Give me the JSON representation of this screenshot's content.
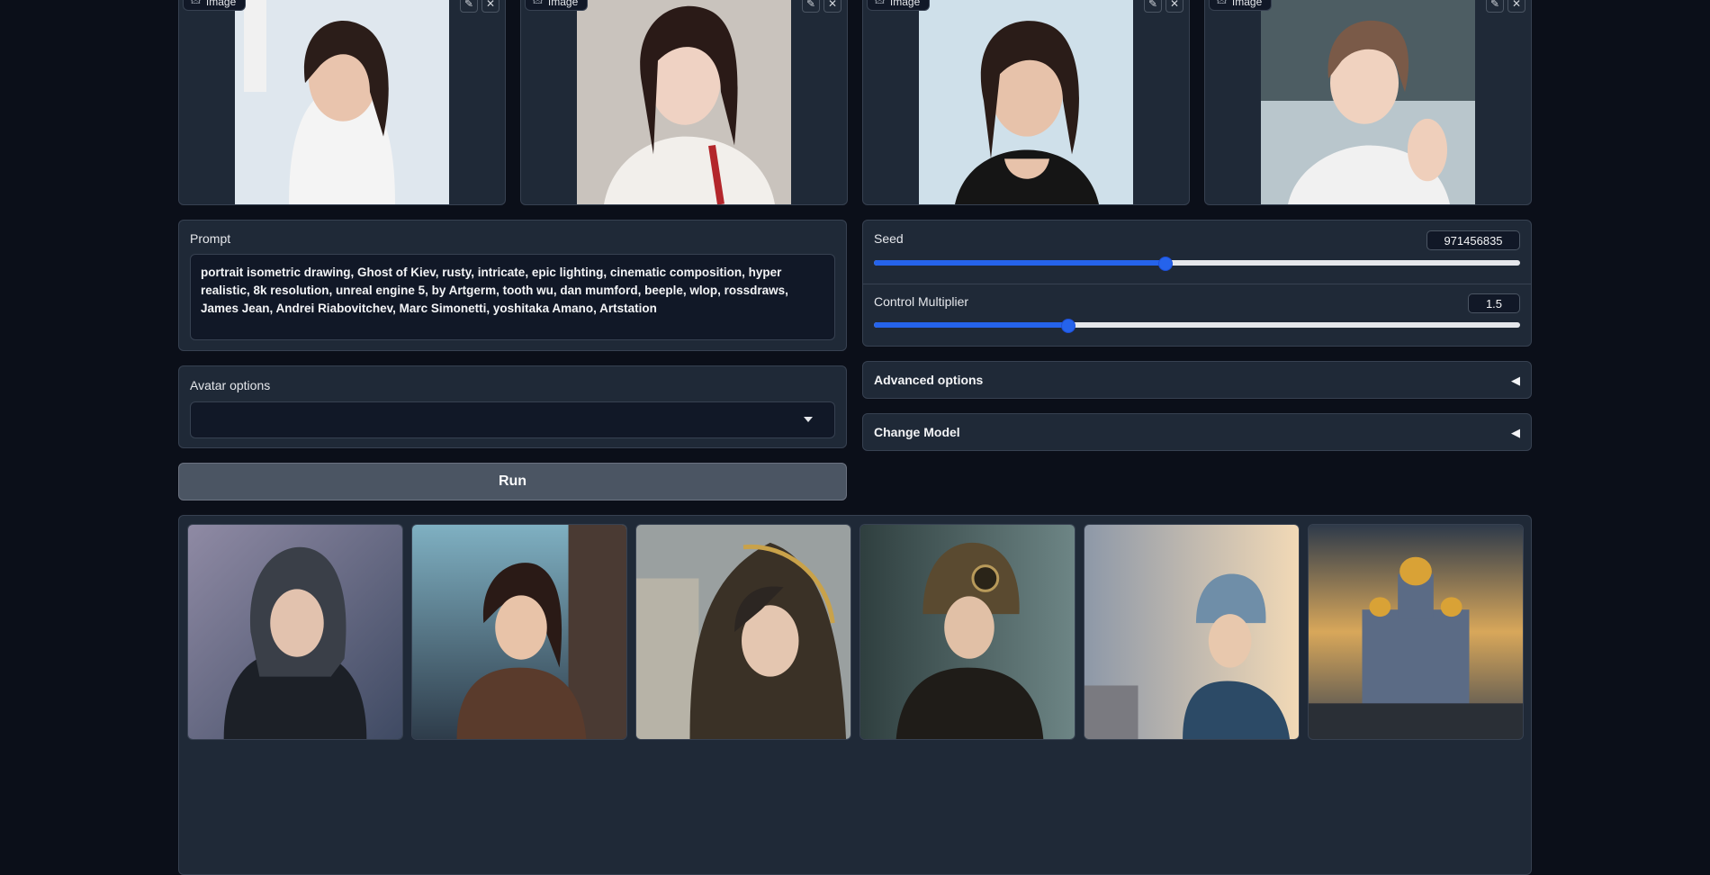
{
  "image_inputs": [
    {
      "tag": "Image",
      "edit_icon": "pencil-icon",
      "close_icon": "close-icon"
    },
    {
      "tag": "Image",
      "edit_icon": "pencil-icon",
      "close_icon": "close-icon"
    },
    {
      "tag": "Image",
      "edit_icon": "pencil-icon",
      "close_icon": "close-icon"
    },
    {
      "tag": "Image",
      "edit_icon": "pencil-icon",
      "close_icon": "close-icon"
    }
  ],
  "prompt": {
    "label": "Prompt",
    "value": "portrait isometric drawing, Ghost of Kiev, rusty, intricate, epic lighting, cinematic composition, hyper realistic, 8k resolution, unreal engine 5, by Artgerm, tooth wu, dan mumford, beeple, wlop, rossdraws, James Jean, Andrei Riabovitchev, Marc Simonetti, yoshitaka Amano, Artstation"
  },
  "avatar_options": {
    "label": "Avatar options",
    "selected": ""
  },
  "seed": {
    "label": "Seed",
    "value": "971456835",
    "fraction": 0.45
  },
  "control_multiplier": {
    "label": "Control Multiplier",
    "value": "1.5",
    "fraction": 0.3
  },
  "advanced_options": {
    "label": "Advanced options",
    "arrow": "◀"
  },
  "change_model": {
    "label": "Change Model",
    "arrow": "◀"
  },
  "run_button": {
    "label": "Run"
  },
  "colors": {
    "accent": "#2563eb",
    "panel": "#1f2937",
    "background": "#0b0f19"
  }
}
